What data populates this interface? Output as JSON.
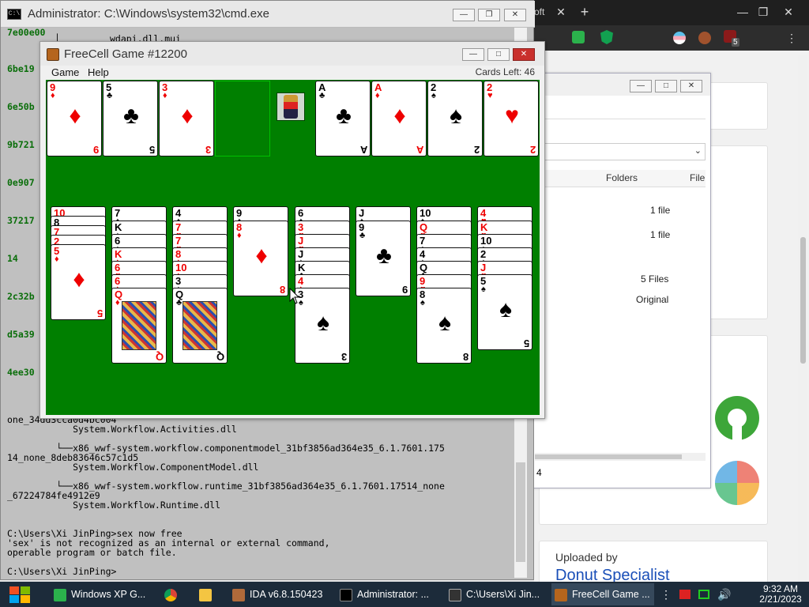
{
  "browser": {
    "close_tab": "✕",
    "new_tab": "+",
    "partial_tab_text": "oft",
    "win_min": "—",
    "win_max": "❐",
    "win_close": "✕",
    "menu": "⋮",
    "ext_badge": "5",
    "page": {
      "uploaded_by": "Uploaded by",
      "uploader": "Donut Specialist"
    }
  },
  "explorer": {
    "column_folders": "Folders",
    "column_file": "File",
    "rows": [
      "1 file",
      "1 file",
      "5 Files",
      "Original"
    ],
    "status_fragment": "4"
  },
  "cmd": {
    "title": "Administrator: C:\\Windows\\system32\\cmd.exe",
    "left_column": [
      "7e00e00",
      "6be19",
      "6e50b",
      "9b721",
      "0e907",
      "37217",
      "14",
      "2c32b",
      "d5a39",
      "4ee30"
    ],
    "tree_fragment": "wdapi.dll.mui",
    "lines": [
      "one_34dd3cca0d4bc004",
      "            System.Workflow.Activities.dll",
      "",
      "         └──x86_wwf-system.workflow.componentmodel_31bf3856ad364e35_6.1.7601.175",
      "14_none_8deb83646c57c1d5",
      "            System.Workflow.ComponentModel.dll",
      "",
      "         └──x86_wwf-system.workflow.runtime_31bf3856ad364e35_6.1.7601.17514_none",
      "_67224784fe4912e9",
      "            System.Workflow.Runtime.dll",
      "",
      "",
      "C:\\Users\\Xi JinPing>sex now free",
      "'sex' is not recognized as an internal or external command,",
      "operable program or batch file.",
      "",
      "C:\\Users\\Xi JinPing>"
    ]
  },
  "freecell": {
    "title": "FreeCell Game #12200",
    "menu": [
      "Game",
      "Help"
    ],
    "cards_left_label": "Cards Left:",
    "cards_left_value": "46",
    "free_cells": [
      {
        "rank": "9",
        "suit": "♦",
        "color": "red"
      },
      {
        "rank": "5",
        "suit": "♣",
        "color": "blk"
      },
      {
        "rank": "3",
        "suit": "♦",
        "color": "red"
      },
      null
    ],
    "foundations": [
      {
        "rank": "A",
        "suit": "♣",
        "color": "blk"
      },
      {
        "rank": "A",
        "suit": "♦",
        "color": "red"
      },
      {
        "rank": "2",
        "suit": "♠",
        "color": "blk"
      },
      {
        "rank": "2",
        "suit": "♥",
        "color": "red"
      }
    ],
    "columns": [
      [
        [
          "10",
          "♥",
          "red"
        ],
        [
          "8",
          "♠",
          "blk"
        ],
        [
          "7",
          "♦",
          "red"
        ],
        [
          "2",
          "♥",
          "red"
        ],
        [
          "5",
          "♦",
          "red"
        ]
      ],
      [
        [
          "7",
          "♠",
          "blk"
        ],
        [
          "K",
          "♠",
          "blk"
        ],
        [
          "6",
          "♠",
          "blk"
        ],
        [
          "K",
          "♦",
          "red"
        ],
        [
          "6",
          "♥",
          "red"
        ],
        [
          "6",
          "♦",
          "red"
        ],
        [
          "Q",
          "♦",
          "red"
        ]
      ],
      [
        [
          "4",
          "♠",
          "blk"
        ],
        [
          "7",
          "♥",
          "red"
        ],
        [
          "7",
          "♥",
          "red"
        ],
        [
          "8",
          "♦",
          "red"
        ],
        [
          "10",
          "♦",
          "red"
        ],
        [
          "3",
          "♠",
          "blk"
        ],
        [
          "Q",
          "♣",
          "blk"
        ]
      ],
      [
        [
          "9",
          "♠",
          "blk"
        ],
        [
          "8",
          "♦",
          "red"
        ]
      ],
      [
        [
          "6",
          "♠",
          "blk"
        ],
        [
          "3",
          "♥",
          "red"
        ],
        [
          "J",
          "♥",
          "red"
        ],
        [
          "J",
          "♠",
          "blk"
        ],
        [
          "K",
          "♣",
          "blk"
        ],
        [
          "4",
          "♦",
          "red"
        ],
        [
          "3",
          "♠",
          "blk"
        ]
      ],
      [
        [
          "J",
          "♠",
          "blk"
        ],
        [
          "9",
          "♣",
          "blk"
        ]
      ],
      [
        [
          "10",
          "♠",
          "blk"
        ],
        [
          "Q",
          "♥",
          "red"
        ],
        [
          "7",
          "♠",
          "blk"
        ],
        [
          "4",
          "♠",
          "blk"
        ],
        [
          "Q",
          "♣",
          "blk"
        ],
        [
          "9",
          "♥",
          "red"
        ],
        [
          "8",
          "♠",
          "blk"
        ]
      ],
      [
        [
          "4",
          "♥",
          "red"
        ],
        [
          "K",
          "♥",
          "red"
        ],
        [
          "10",
          "♠",
          "blk"
        ],
        [
          "2",
          "♠",
          "blk"
        ],
        [
          "J",
          "♥",
          "red"
        ],
        [
          "5",
          "♠",
          "blk"
        ]
      ]
    ]
  },
  "taskbar": {
    "items": [
      "Windows XP G...",
      "",
      "",
      "IDA v6.8.150423",
      "Administrator: ...",
      "C:\\Users\\Xi Jin...",
      "FreeCell Game ..."
    ],
    "time": "9:32 AM",
    "date": "2/21/2023"
  },
  "colors": {
    "felt": "#007f00",
    "taskbar": "#1c2b3a",
    "cmd_bg": "#c0c0c0",
    "red_suit": "#e00000",
    "link_blue": "#1a4fb8"
  }
}
